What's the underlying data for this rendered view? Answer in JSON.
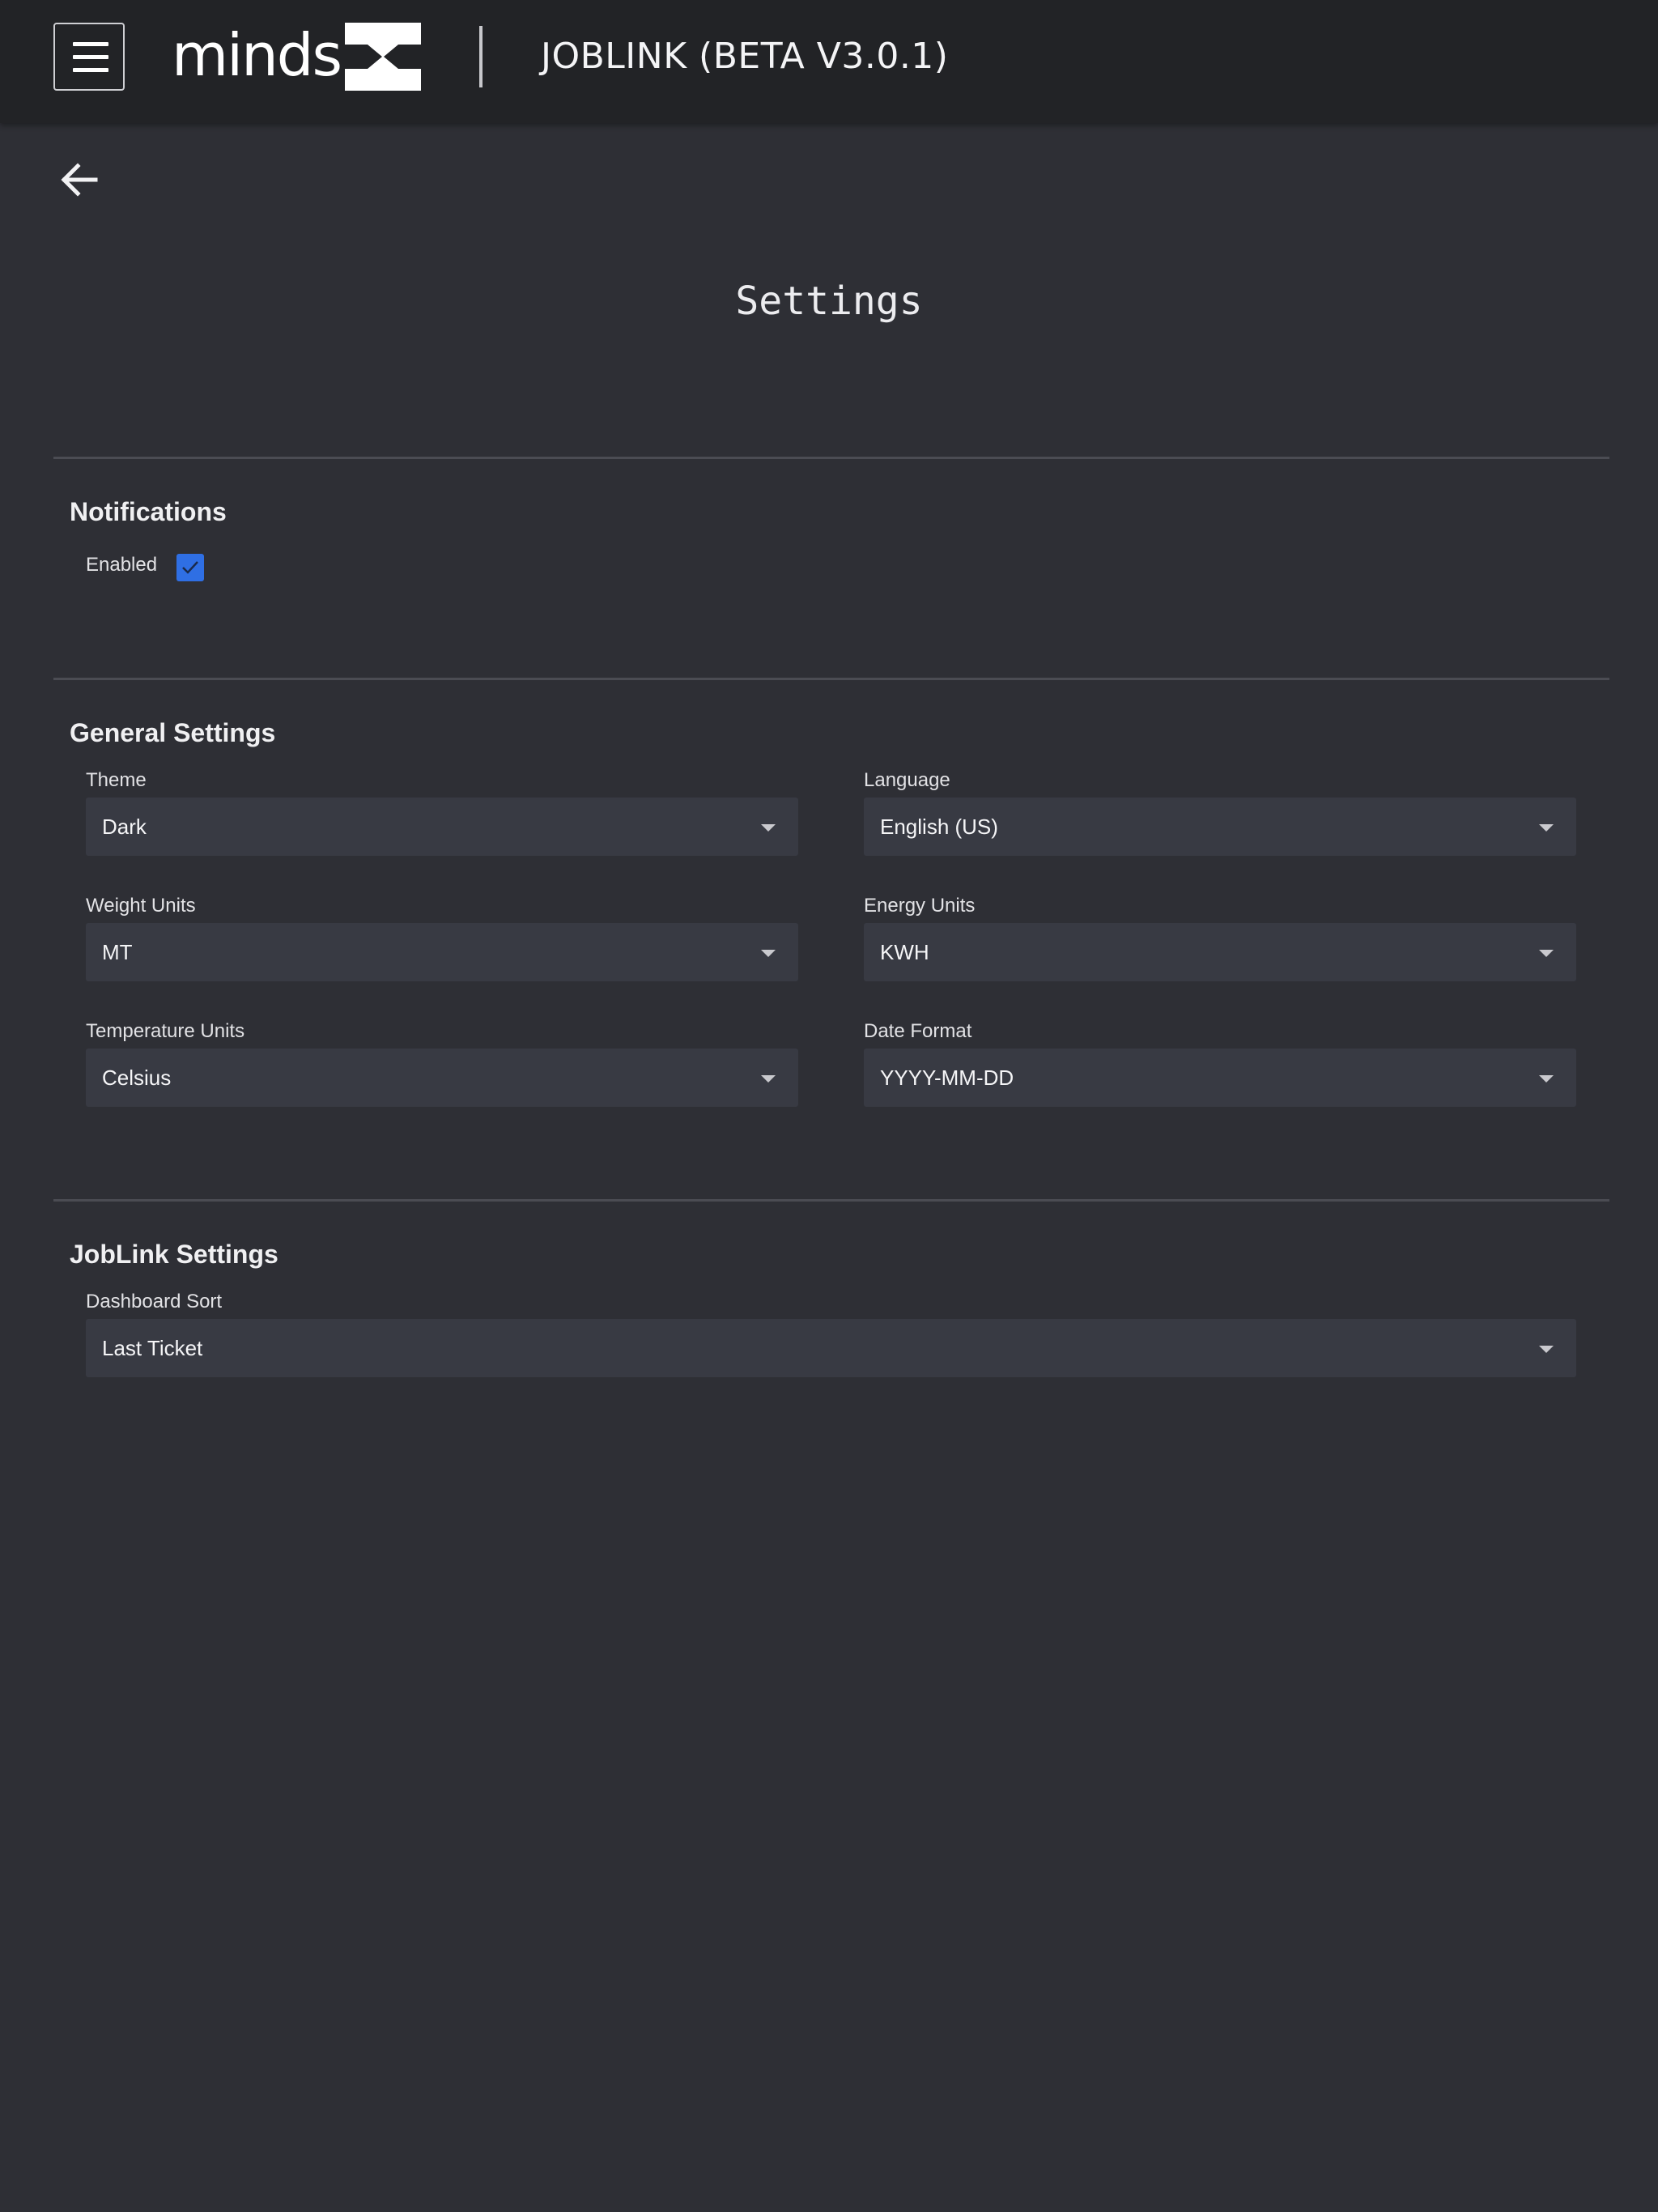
{
  "header": {
    "logo_text": "minds",
    "app_title": "JOBLINK (BETA V3.0.1)",
    "menu_icon": "hamburger-menu-icon"
  },
  "page": {
    "title": "Settings",
    "back_icon": "arrow-left-icon"
  },
  "notifications": {
    "section_title": "Notifications",
    "enabled_label": "Enabled",
    "enabled_checked": true,
    "checkbox_color": "#2f6fe4"
  },
  "general_settings": {
    "section_title": "General Settings",
    "theme": {
      "label": "Theme",
      "value": "Dark"
    },
    "language": {
      "label": "Language",
      "value": "English (US)"
    },
    "weight_units": {
      "label": "Weight Units",
      "value": "MT"
    },
    "energy_units": {
      "label": "Energy Units",
      "value": "KWH"
    },
    "temperature_units": {
      "label": "Temperature Units",
      "value": "Celsius"
    },
    "date_format": {
      "label": "Date Format",
      "value": "YYYY-MM-DD"
    }
  },
  "joblink_settings": {
    "section_title": "JobLink Settings",
    "dashboard_sort": {
      "label": "Dashboard Sort",
      "value": "Last Ticket"
    }
  }
}
